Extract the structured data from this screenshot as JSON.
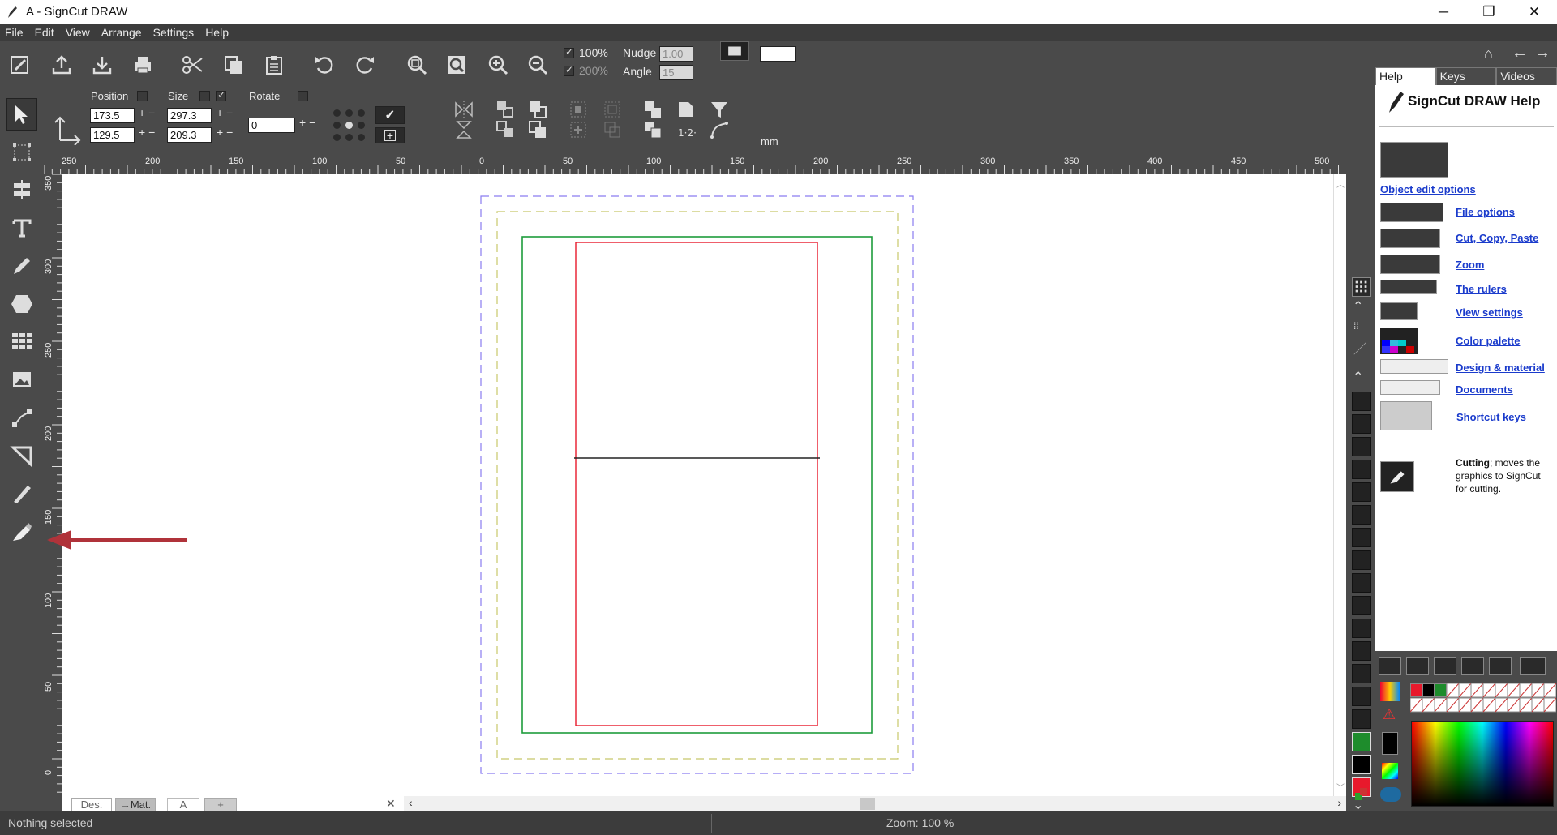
{
  "window": {
    "title": "A - SignCut DRAW"
  },
  "menu": [
    "File",
    "Edit",
    "View",
    "Arrange",
    "Settings",
    "Help"
  ],
  "toolbar": {
    "zoom_100": "100%",
    "zoom_200": "200%",
    "nudge_label": "Nudge",
    "nudge_value": "1.00",
    "angle_label": "Angle",
    "angle_value": "15",
    "position_label": "Position",
    "size_label": "Size",
    "rotate_label": "Rotate",
    "pos_x": "173.5",
    "pos_y": "129.5",
    "size_w": "297.3",
    "size_h": "209.3",
    "rotate_value": "0",
    "unit": "mm"
  },
  "ruler": {
    "top_ticks": [
      "250",
      "200",
      "150",
      "100",
      "50",
      "0",
      "50",
      "100",
      "150",
      "200",
      "250",
      "300",
      "350",
      "400",
      "450",
      "500"
    ],
    "left_ticks": [
      "350",
      "300",
      "250",
      "200",
      "150",
      "100",
      "50",
      "0"
    ]
  },
  "doc_tabs": {
    "design": "Des.",
    "material": "→Mat.",
    "doc_a": "A",
    "add": "+"
  },
  "help": {
    "tabs": [
      "Help",
      "Keys",
      "Videos"
    ],
    "title": "SignCut DRAW Help",
    "object_edit": "Object edit options",
    "links": [
      "File options",
      "Cut, Copy, Paste",
      "Zoom",
      "The rulers",
      "View settings",
      "Color palette",
      "Design & material",
      "Documents",
      "Shortcut keys"
    ],
    "cutting_bold": "Cutting",
    "cutting_text": "; moves the graphics to SignCut for cutting."
  },
  "status": {
    "left": "Nothing selected",
    "zoom": "Zoom: 100 %"
  },
  "colors": {
    "accent_arrow": "#b0333a",
    "green": "#1e9c3c",
    "red": "#e8192c",
    "purple": "#8a7cf0",
    "olive": "#c8c86a"
  }
}
